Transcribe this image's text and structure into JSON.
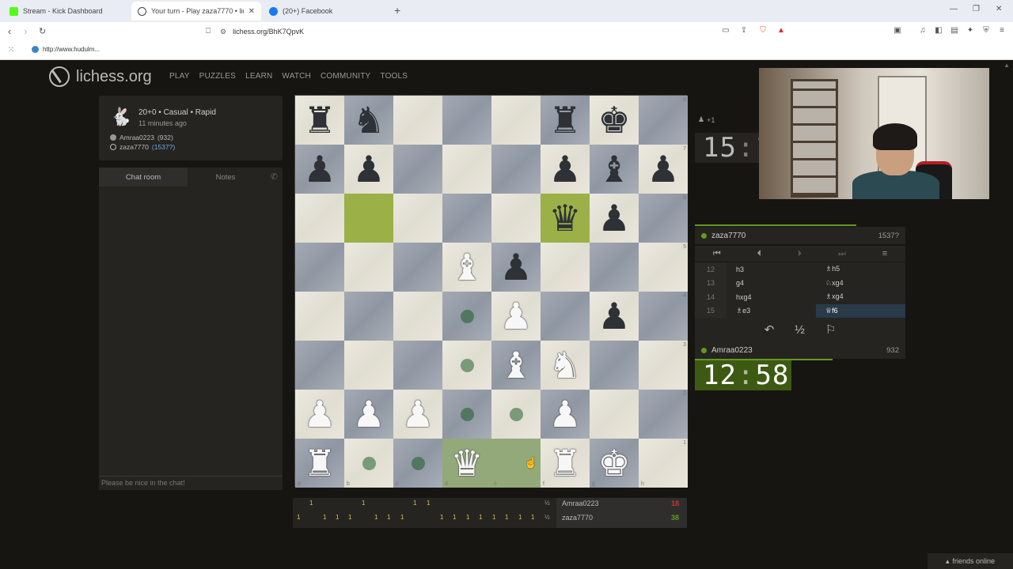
{
  "browser": {
    "tabs": [
      {
        "title": "Stream - Kick Dashboard",
        "favicon_color": "#53fc18"
      },
      {
        "title": "Your turn - Play zaza7770 • liche",
        "favicon_color": "#444444"
      },
      {
        "title": "(20+) Facebook",
        "favicon_color": "#1877f2"
      }
    ],
    "url": "lichess.org/BhK7QpvK",
    "bookmark": "http://www.hudulm..."
  },
  "site": {
    "logo": "lichess.org",
    "nav": [
      "PLAY",
      "PUZZLES",
      "LEARN",
      "WATCH",
      "COMMUNITY",
      "TOOLS"
    ]
  },
  "game_info": {
    "title": "20+0 • Casual • Rapid",
    "ago": "11 minutes ago",
    "white_player": "Amraa0223",
    "white_rating": "(932)",
    "black_player": "zaza7770",
    "black_rating": "(1537?)"
  },
  "chat": {
    "tab_chat": "Chat room",
    "tab_notes": "Notes",
    "placeholder": "Please be nice in the chat!"
  },
  "board": {
    "rows": [
      [
        "bR",
        "bN",
        "",
        "",
        "",
        "bR",
        "bK",
        ""
      ],
      [
        "bP",
        "bP",
        "",
        "",
        "",
        "bP",
        "bB",
        "bP"
      ],
      [
        "",
        "",
        "",
        "",
        "",
        "bQ",
        "bP",
        ""
      ],
      [
        "",
        "",
        "",
        "wB",
        "bP",
        "",
        "",
        ""
      ],
      [
        "",
        "",
        "",
        "",
        "wP",
        "",
        "bP",
        ""
      ],
      [
        "",
        "",
        "",
        "",
        "wB",
        "wN",
        "",
        ""
      ],
      [
        "wP",
        "wP",
        "wP",
        "",
        "",
        "wP",
        "",
        ""
      ],
      [
        "wR",
        "",
        "",
        "wQ",
        "",
        "wR",
        "wK",
        ""
      ]
    ],
    "highlights": [
      [
        2,
        1
      ],
      [
        2,
        5
      ]
    ],
    "selected": [
      [
        7,
        3
      ],
      [
        7,
        4
      ]
    ],
    "dests": [
      [
        4,
        3
      ],
      [
        5,
        3
      ],
      [
        6,
        3
      ],
      [
        6,
        4
      ],
      [
        7,
        1
      ],
      [
        7,
        2
      ]
    ],
    "ranks": [
      "8",
      "7",
      "6",
      "5",
      "4",
      "3",
      "2",
      "1"
    ],
    "files": [
      "a",
      "b",
      "c",
      "d",
      "e",
      "f",
      "g",
      "h"
    ]
  },
  "crosstable": {
    "white_name": "Amraa0223",
    "white_total": "18",
    "black_name": "zaza7770",
    "black_total": "38",
    "half": "½",
    "win_mark": "1"
  },
  "right": {
    "spectators": "+1",
    "top_clock": {
      "min": "15",
      "sec": "15"
    },
    "top_player": "zaza7770",
    "top_rating": "1537?",
    "bot_clock": {
      "min": "12",
      "sec": "58"
    },
    "bot_player": "Amraa0223",
    "bot_rating": "932",
    "moves": [
      {
        "n": "12",
        "w": "h3",
        "b": "♗h5"
      },
      {
        "n": "13",
        "w": "g4",
        "b": "♘xg4"
      },
      {
        "n": "14",
        "w": "hxg4",
        "b": "♗xg4"
      },
      {
        "n": "15",
        "w": "♗e3",
        "b": "♕f6"
      }
    ],
    "draw_label": "½"
  },
  "footer": {
    "friends": "friends online"
  }
}
